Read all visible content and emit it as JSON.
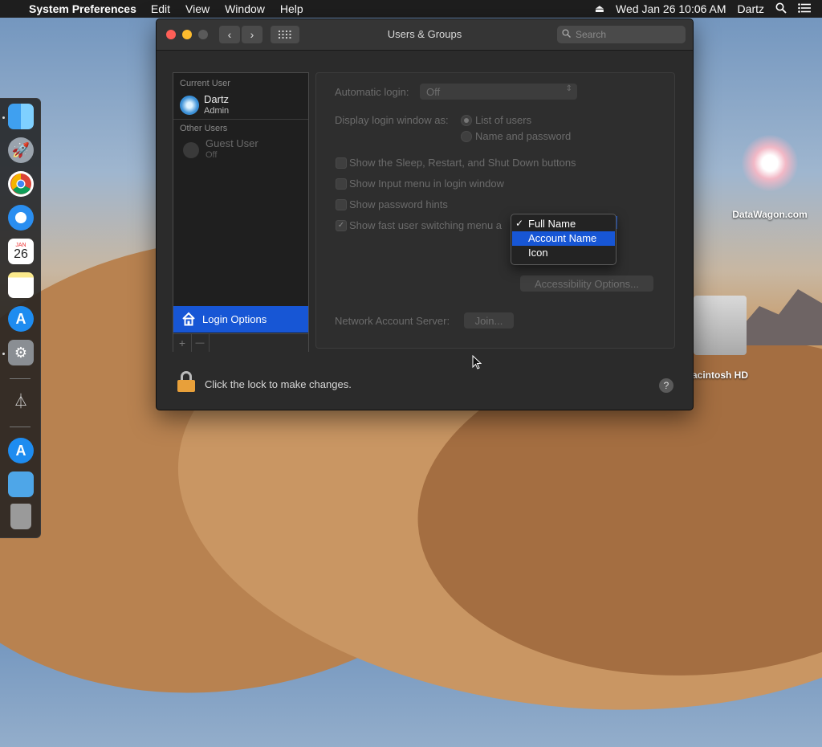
{
  "menubar": {
    "app_name": "System Preferences",
    "items": [
      "Edit",
      "View",
      "Window",
      "Help"
    ],
    "datetime": "Wed Jan 26  10:06 AM",
    "user": "Dartz"
  },
  "desktop": {
    "watermark_label": "DataWagon.com",
    "drive_label": "acintosh HD"
  },
  "dock": {
    "calendar_month": "JAN",
    "calendar_day": "26"
  },
  "window": {
    "title": "Users & Groups",
    "search_placeholder": "Search"
  },
  "sidebar": {
    "current_user_header": "Current User",
    "current_user": {
      "name": "Dartz",
      "role": "Admin"
    },
    "other_users_header": "Other Users",
    "guest_user": {
      "name": "Guest User",
      "status": "Off"
    },
    "login_options_label": "Login Options",
    "add_symbol": "+",
    "remove_symbol": "—"
  },
  "panel": {
    "automatic_login_label": "Automatic login:",
    "automatic_login_value": "Off",
    "display_login_label": "Display login window as:",
    "radio_list_users": "List of users",
    "radio_name_password": "Name and password",
    "cb_sleep": "Show the Sleep, Restart, and Shut Down buttons",
    "cb_input_menu": "Show Input menu in login window",
    "cb_password_hints": "Show password hints",
    "cb_fast_switching": "Show fast user switching menu a",
    "accessibility_button": "Accessibility Options...",
    "network_label": "Network Account Server:",
    "join_button": "Join..."
  },
  "dropdown": {
    "items": [
      {
        "label": "Full Name",
        "checked": true,
        "selected": false
      },
      {
        "label": "Account Name",
        "checked": false,
        "selected": true
      },
      {
        "label": "Icon",
        "checked": false,
        "selected": false
      }
    ],
    "check_mark": "✓"
  },
  "footer": {
    "lock_text": "Click the lock to make changes.",
    "help_symbol": "?"
  }
}
